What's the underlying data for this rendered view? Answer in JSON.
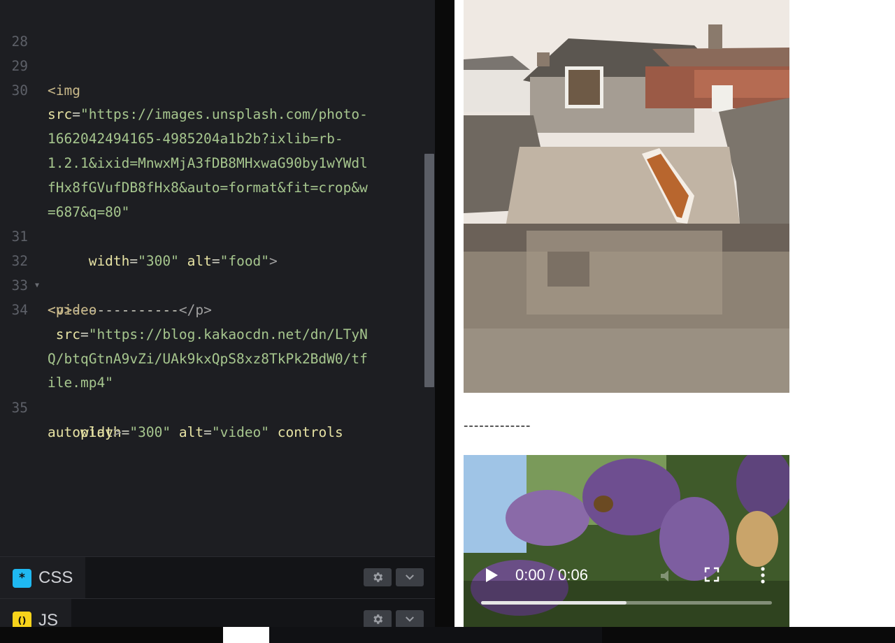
{
  "editor": {
    "lines": [
      {
        "num": "28",
        "text": ""
      },
      {
        "num": "29",
        "text": "<img"
      },
      {
        "num": "30",
        "text": ""
      },
      {
        "num": "",
        "text": "src=\"https://images.unsplash.com/photo-"
      },
      {
        "num": "",
        "text": "1662042494165-4985204a1b2b?ixlib=rb-"
      },
      {
        "num": "",
        "text": "1.2.1&ixid=MnwxMjA3fDB8MHxwaG90by1wYWdl"
      },
      {
        "num": "",
        "text": "fHx8fGVufDB8fHx8&auto=format&fit=crop&w"
      },
      {
        "num": "",
        "text": "=687&q=80\""
      },
      {
        "num": "31",
        "text": "     width=\"300\" alt=\"food\">"
      },
      {
        "num": "32",
        "text": "<p>-------------</p>"
      },
      {
        "num": "33",
        "text": "<video"
      },
      {
        "num": "34",
        "text": ""
      },
      {
        "num": "",
        "text": " src=\"https://blog.kakaocdn.net/dn/LTyN"
      },
      {
        "num": "",
        "text": "Q/btqGtnA9vZi/UAk9kxQpS8xz8TkPk2BdW0/tf"
      },
      {
        "num": "",
        "text": "ile.mp4\""
      },
      {
        "num": "35",
        "text": "    width=\"300\" alt=\"video\" controls"
      },
      {
        "num": "",
        "text": "autoplay>"
      }
    ]
  },
  "panels": {
    "css": {
      "label": "CSS",
      "icon": "asterisk-icon",
      "icon_glyph": "*",
      "color": "#1fb9f2"
    },
    "js": {
      "label": "JS",
      "icon": "braces-icon",
      "icon_glyph": "()",
      "color": "#f7d31b"
    }
  },
  "preview": {
    "separator_text": "-------------",
    "video": {
      "time": "0:00 / 0:06",
      "progress": 0.5
    }
  }
}
